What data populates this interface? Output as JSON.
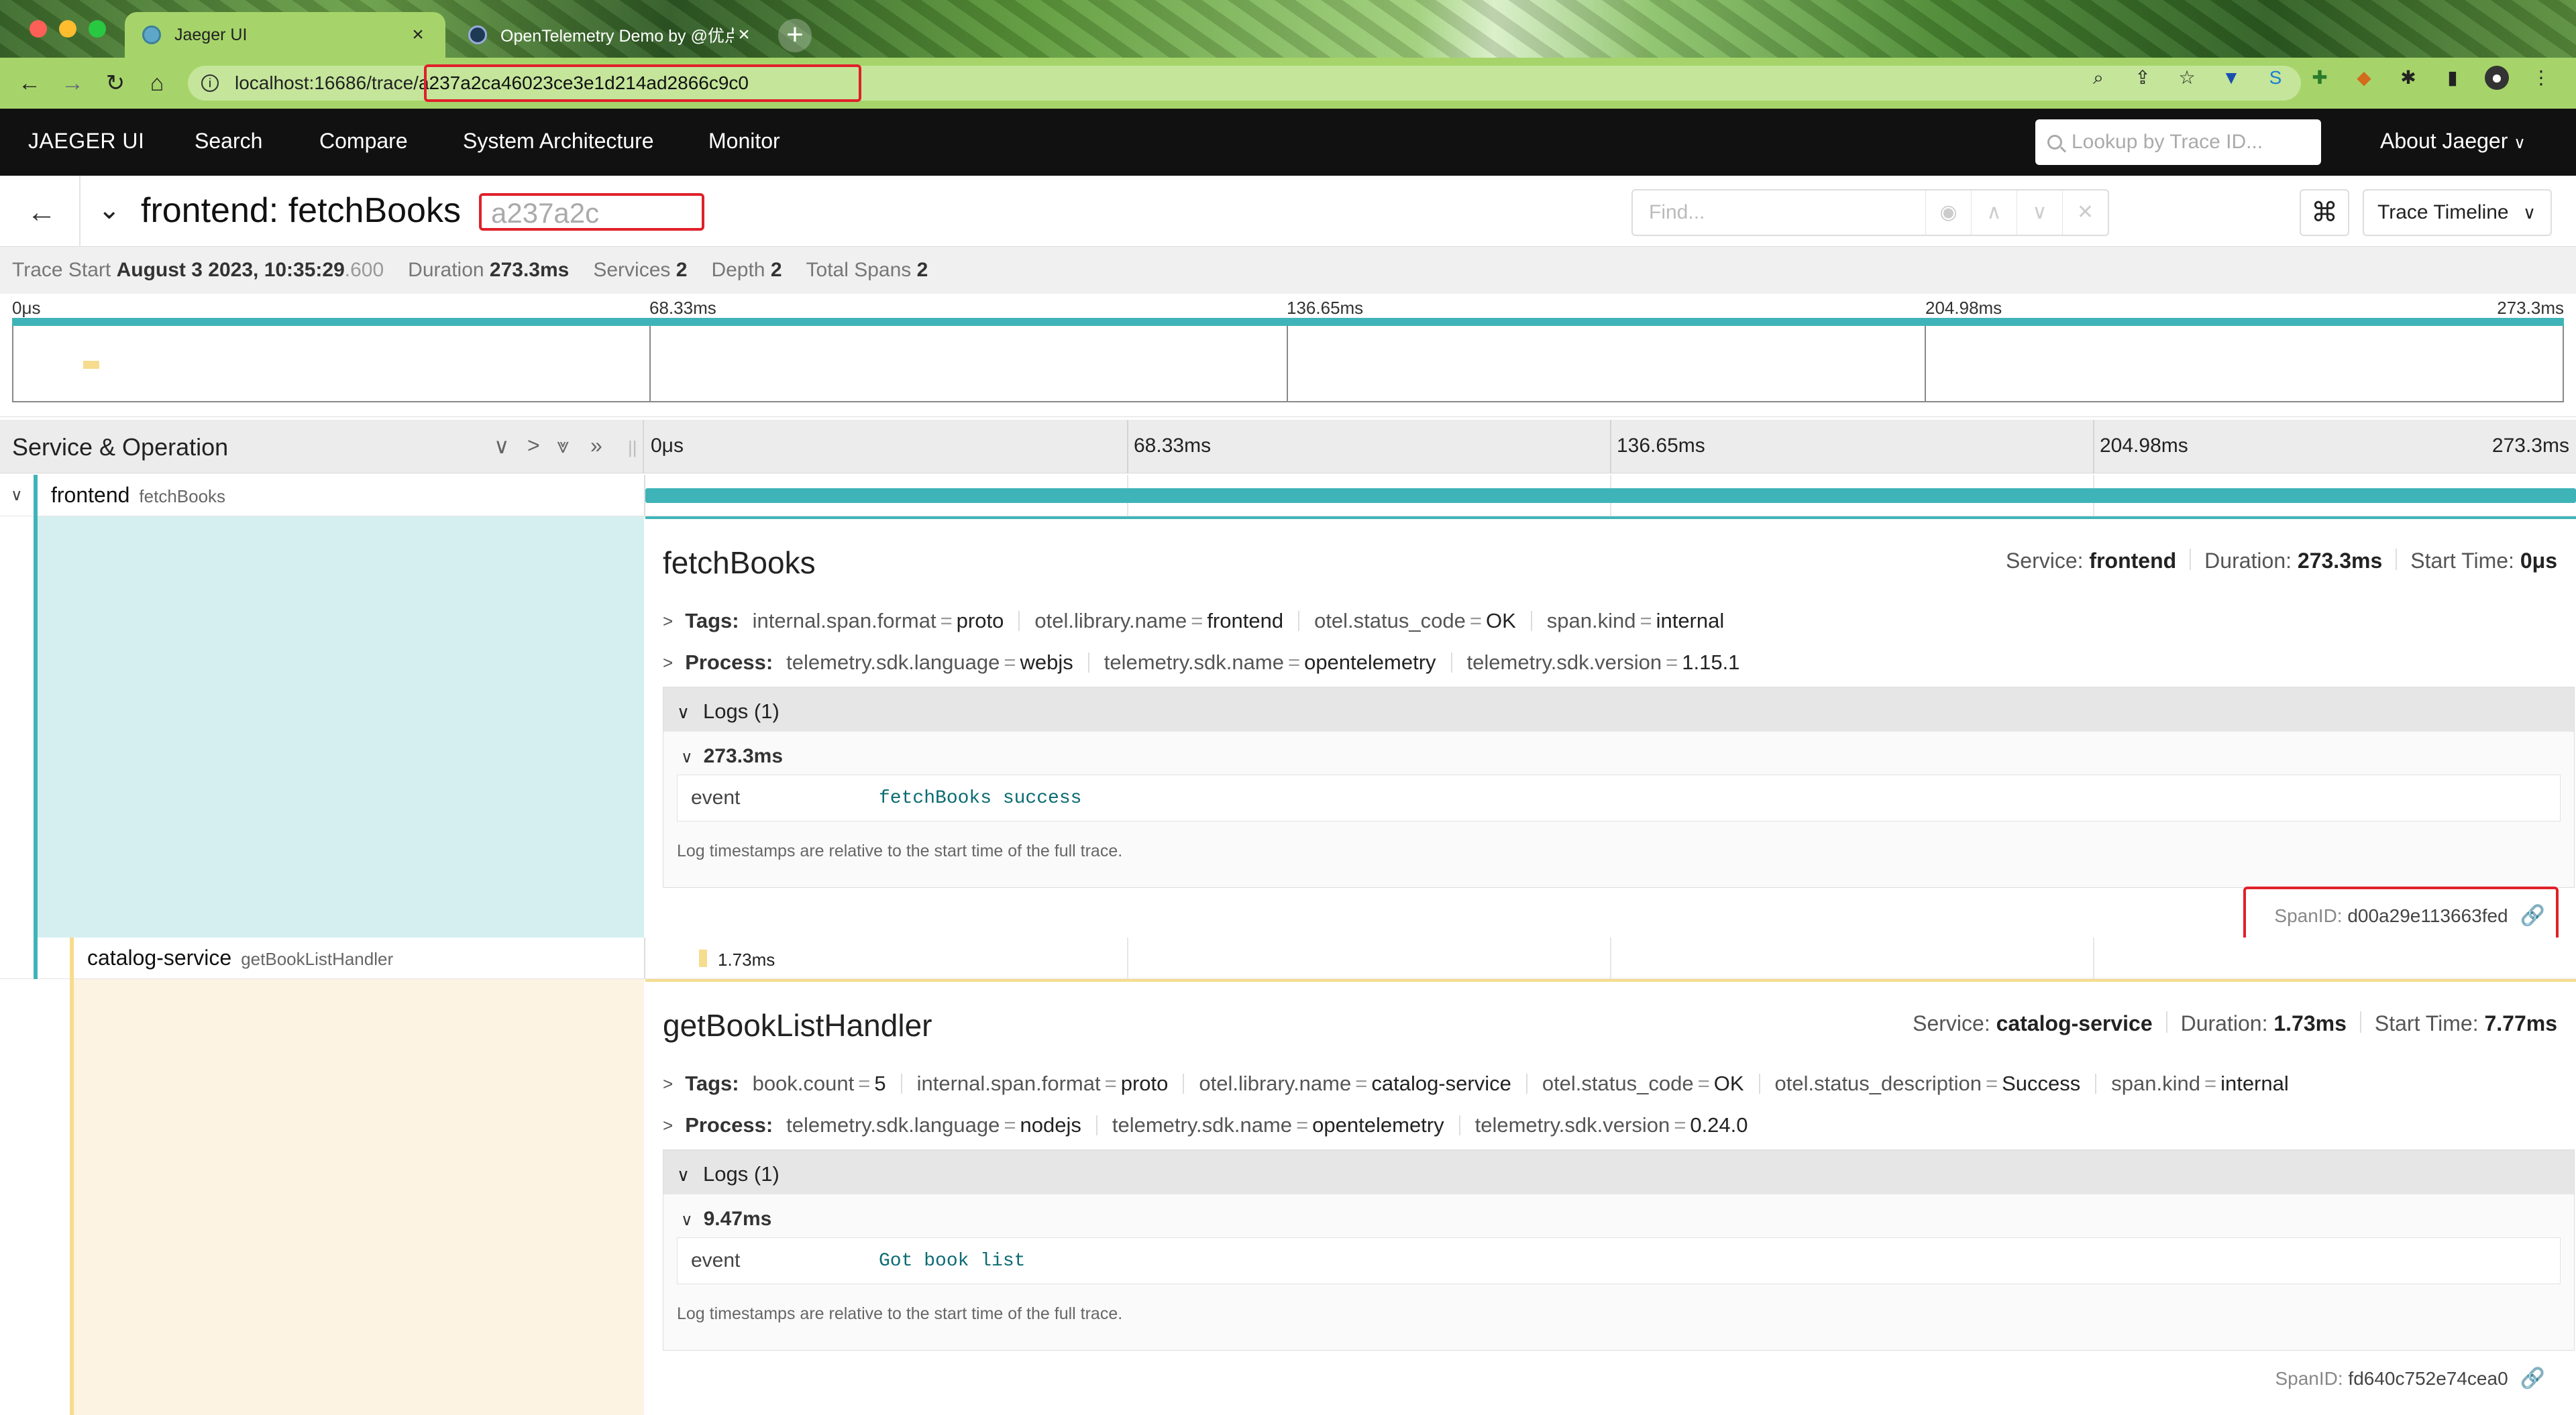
{
  "browser": {
    "tabs": [
      {
        "title": "Jaeger UI",
        "active": true
      },
      {
        "title": "OpenTelemetry Demo by @优点",
        "active": false
      }
    ],
    "url_host": "localhost:16686/trace/",
    "url_path": "a237a2ca46023ce3e1d214ad2866c9c0"
  },
  "nav": {
    "brand": "JAEGER UI",
    "links": [
      "Search",
      "Compare",
      "System Architecture",
      "Monitor"
    ],
    "lookup_placeholder": "Lookup by Trace ID...",
    "about": "About Jaeger"
  },
  "trace": {
    "title": "frontend: fetchBooks",
    "short_id": "a237a2c",
    "find_placeholder": "Find...",
    "view_mode": "Trace Timeline",
    "meta": {
      "trace_start_label": "Trace Start",
      "trace_start": "August 3 2023, 10:35:29",
      "trace_start_ms": ".600",
      "duration_label": "Duration",
      "duration": "273.3ms",
      "services_label": "Services",
      "services": "2",
      "depth_label": "Depth",
      "depth": "2",
      "total_spans_label": "Total Spans",
      "total_spans": "2"
    },
    "ticks": [
      "0μs",
      "68.33ms",
      "136.65ms",
      "204.98ms",
      "273.3ms"
    ]
  },
  "columns": {
    "title": "Service & Operation"
  },
  "spans": [
    {
      "service": "frontend",
      "operation": "fetchBooks",
      "title": "fetchBooks",
      "service_label": "Service:",
      "duration_label": "Duration:",
      "duration": "273.3ms",
      "start_label": "Start Time:",
      "start": "0μs",
      "tags_label": "Tags:",
      "tags": [
        {
          "k": "internal.span.format",
          "v": "proto"
        },
        {
          "k": "otel.library.name",
          "v": "frontend"
        },
        {
          "k": "otel.status_code",
          "v": "OK"
        },
        {
          "k": "span.kind",
          "v": "internal"
        }
      ],
      "process_label": "Process:",
      "process": [
        {
          "k": "telemetry.sdk.language",
          "v": "webjs"
        },
        {
          "k": "telemetry.sdk.name",
          "v": "opentelemetry"
        },
        {
          "k": "telemetry.sdk.version",
          "v": "1.15.1"
        }
      ],
      "logs_label": "Logs",
      "logs_count": "(1)",
      "log_ts": "273.3ms",
      "log_key": "event",
      "log_value": "fetchBooks success",
      "log_note": "Log timestamps are relative to the start time of the full trace.",
      "spanid_label": "SpanID:",
      "spanid": "d00a29e113663fed"
    },
    {
      "service": "catalog-service",
      "operation": "getBookListHandler",
      "bar_label": "1.73ms",
      "title": "getBookListHandler",
      "service_label": "Service:",
      "duration_label": "Duration:",
      "duration": "1.73ms",
      "start_label": "Start Time:",
      "start": "7.77ms",
      "tags_label": "Tags:",
      "tags": [
        {
          "k": "book.count",
          "v": "5"
        },
        {
          "k": "internal.span.format",
          "v": "proto"
        },
        {
          "k": "otel.library.name",
          "v": "catalog-service"
        },
        {
          "k": "otel.status_code",
          "v": "OK"
        },
        {
          "k": "otel.status_description",
          "v": "Success"
        },
        {
          "k": "span.kind",
          "v": "internal"
        }
      ],
      "process_label": "Process:",
      "process": [
        {
          "k": "telemetry.sdk.language",
          "v": "nodejs"
        },
        {
          "k": "telemetry.sdk.name",
          "v": "opentelemetry"
        },
        {
          "k": "telemetry.sdk.version",
          "v": "0.24.0"
        }
      ],
      "logs_label": "Logs",
      "logs_count": "(1)",
      "log_ts": "9.47ms",
      "log_key": "event",
      "log_value": "Got book list",
      "log_note": "Log timestamps are relative to the start time of the full trace.",
      "spanid_label": "SpanID:",
      "spanid": "fd640c752e74cea0"
    }
  ],
  "colors": {
    "frontend": "#3fb4b8",
    "frontend_bg": "#d5eff1",
    "catalog": "#f6dc8e",
    "catalog_bg": "#fdf3e3",
    "highlight": "#e0202a"
  }
}
